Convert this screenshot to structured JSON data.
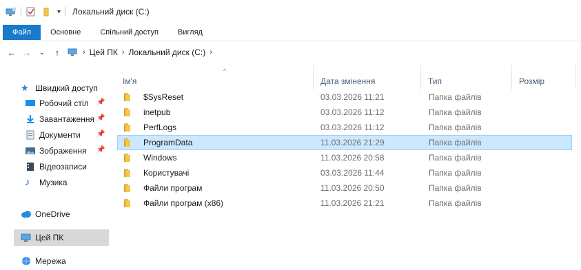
{
  "window": {
    "title": "Локальний диск (C:)"
  },
  "ribbon": {
    "tabs": [
      "Файл",
      "Основне",
      "Спільний доступ",
      "Вигляд"
    ]
  },
  "address": {
    "crumbs": [
      "Цей ПК",
      "Локальний диск (C:)"
    ]
  },
  "navpane": {
    "quick_access": "Швидкий доступ",
    "pinned": [
      {
        "label": "Робочий стіл",
        "icon": "desktop-icon",
        "pinned": true
      },
      {
        "label": "Завантаження",
        "icon": "downloads-icon",
        "pinned": true
      },
      {
        "label": "Документи",
        "icon": "documents-icon",
        "pinned": true
      },
      {
        "label": "Зображення",
        "icon": "pictures-icon",
        "pinned": true
      },
      {
        "label": "Відеозаписи",
        "icon": "videos-icon",
        "pinned": false
      },
      {
        "label": "Музика",
        "icon": "music-icon",
        "pinned": false
      }
    ],
    "onedrive": "OneDrive",
    "this_pc": "Цей ПК",
    "network": "Мережа"
  },
  "columns": {
    "name": "Ім'я",
    "date": "Дата змінення",
    "type": "Тип",
    "size": "Розмір"
  },
  "files": [
    {
      "name": "$SysReset",
      "date": "03.03.2026 11:21",
      "type": "Папка файлів"
    },
    {
      "name": "inetpub",
      "date": "03.03.2026 11:12",
      "type": "Папка файлів"
    },
    {
      "name": "PerfLogs",
      "date": "03.03.2026 11:12",
      "type": "Папка файлів"
    },
    {
      "name": "ProgramData",
      "date": "11.03.2026 21:29",
      "type": "Папка файлів",
      "selected": true
    },
    {
      "name": "Windows",
      "date": "11.03.2026 20:58",
      "type": "Папка файлів"
    },
    {
      "name": "Користувачі",
      "date": "03.03.2026 11:44",
      "type": "Папка файлів"
    },
    {
      "name": "Файли програм",
      "date": "11.03.2026 20:50",
      "type": "Папка файлів"
    },
    {
      "name": "Файли програм (x86)",
      "date": "11.03.2026 21:21",
      "type": "Папка файлів"
    }
  ],
  "colors": {
    "file_tab": "#1979ca",
    "selection": "#cce8ff",
    "selection_border": "#99d1ff",
    "nav_selected": "#d9d9d9"
  }
}
